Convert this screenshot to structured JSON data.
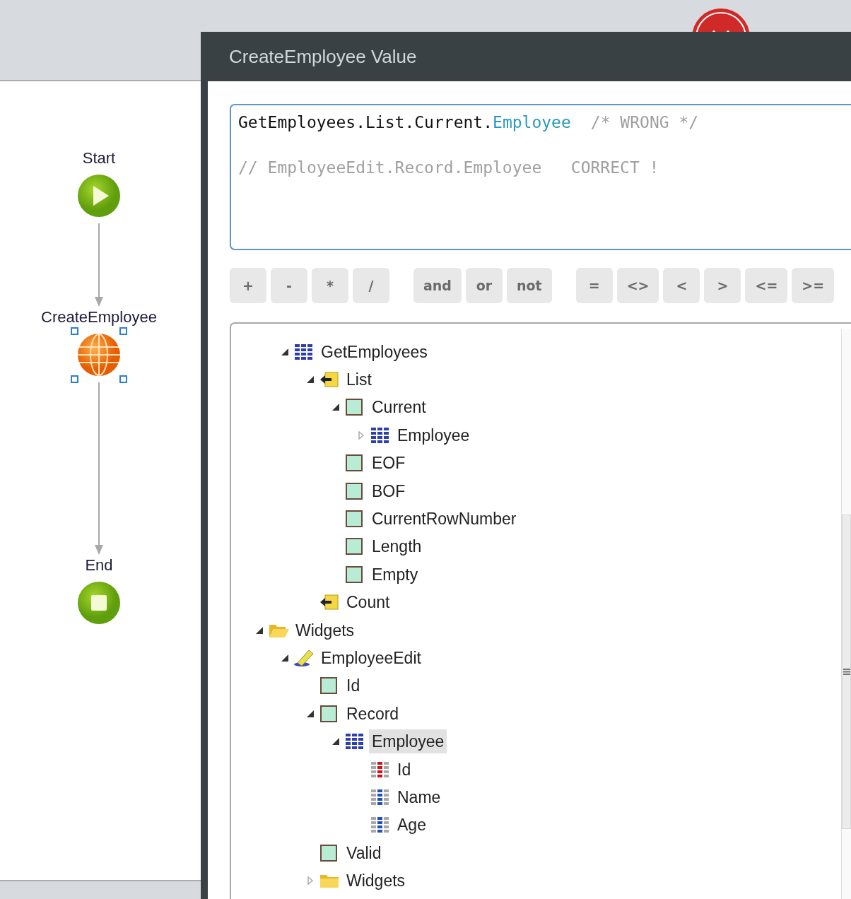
{
  "window": {
    "title": "CreateEmployee Value"
  },
  "flow": {
    "nodes": [
      {
        "kind": "start",
        "label": "Start",
        "selected": false
      },
      {
        "kind": "action",
        "label": "CreateEmployee",
        "selected": true
      },
      {
        "kind": "end",
        "label": "End",
        "selected": false
      }
    ]
  },
  "expression": {
    "lines": [
      {
        "segments": [
          {
            "kind": "code",
            "text": "GetEmployees.List.Current."
          },
          {
            "kind": "entity",
            "text": "Employee"
          },
          {
            "kind": "comment",
            "text": "/* WRONG */"
          }
        ]
      },
      {
        "segments": [
          {
            "kind": "comment",
            "text": "// EmployeeEdit.Record.Employee   CORRECT !"
          }
        ]
      }
    ]
  },
  "operators": [
    [
      "+",
      "-",
      "*",
      "/"
    ],
    [
      "and",
      "or",
      "not"
    ],
    [
      "=",
      "<>",
      "<",
      ">",
      "<=",
      ">="
    ]
  ],
  "tree": {
    "items": [
      {
        "children": [
          {
            "kind": "entity",
            "label": "GetEmployees",
            "expanded": true,
            "selected": false,
            "children": [
              {
                "kind": "list",
                "label": "List",
                "expanded": true,
                "selected": false,
                "children": [
                  {
                    "kind": "attribute",
                    "label": "Current",
                    "expanded": true,
                    "selected": false,
                    "children": [
                      {
                        "kind": "entity",
                        "label": "Employee",
                        "expanded": false,
                        "selected": false
                      }
                    ]
                  },
                  {
                    "kind": "attribute",
                    "label": "EOF",
                    "selected": false
                  },
                  {
                    "kind": "attribute",
                    "label": "BOF",
                    "selected": false
                  },
                  {
                    "kind": "attribute",
                    "label": "CurrentRowNumber",
                    "selected": false
                  },
                  {
                    "kind": "attribute",
                    "label": "Length",
                    "selected": false
                  },
                  {
                    "kind": "attribute",
                    "label": "Empty",
                    "selected": false
                  }
                ]
              },
              {
                "kind": "list",
                "label": "Count",
                "selected": false
              }
            ]
          }
        ]
      },
      {
        "kind": "folder-open",
        "label": "Widgets",
        "expanded": true,
        "selected": false,
        "children": [
          {
            "kind": "edit-widget",
            "label": "EmployeeEdit",
            "expanded": true,
            "selected": false,
            "children": [
              {
                "kind": "attribute",
                "label": "Id",
                "selected": false
              },
              {
                "kind": "attribute",
                "label": "Record",
                "expanded": true,
                "selected": false,
                "children": [
                  {
                    "kind": "entity",
                    "label": "Employee",
                    "expanded": true,
                    "selected": true,
                    "children": [
                      {
                        "kind": "key-field",
                        "label": "Id",
                        "selected": false
                      },
                      {
                        "kind": "field",
                        "label": "Name",
                        "selected": false
                      },
                      {
                        "kind": "field",
                        "label": "Age",
                        "selected": false
                      }
                    ]
                  }
                ]
              },
              {
                "kind": "attribute",
                "label": "Valid",
                "selected": false
              },
              {
                "kind": "folder",
                "label": "Widgets",
                "expanded": false,
                "selected": false
              }
            ]
          }
        ]
      }
    ]
  }
}
